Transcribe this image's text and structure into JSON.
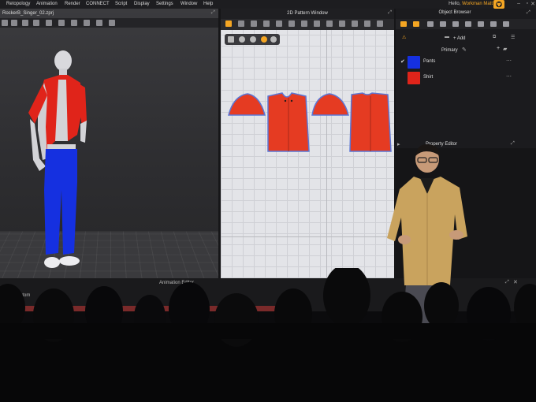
{
  "menu": {
    "items": [
      "Retopology",
      "Animation",
      "Render",
      "CONNECT",
      "Script",
      "Display",
      "Settings",
      "Window",
      "Help"
    ],
    "user_greeting": "Hello,",
    "user_name": "Workman Matt"
  },
  "viewport": {
    "file_name": "RockerB_Singer_02.zprj"
  },
  "pattern_window": {
    "title": "2D Pattern Window"
  },
  "object_browser": {
    "title": "Object Browser",
    "add_label": "+ Add",
    "group_label": "Primary",
    "items": [
      {
        "label": "Pants",
        "color": "#1530e0",
        "checked": true
      },
      {
        "label": "Shirt",
        "color": "#e0241a",
        "checked": false
      }
    ]
  },
  "property_editor": {
    "title": "Property Editor"
  },
  "timeline": {
    "title": "Animation Editor",
    "custom_label": "ustom"
  },
  "colors": {
    "accent": "#f5a623",
    "shirt": "#e0241a",
    "pants": "#1530e0",
    "pattern_red": "#e53b22",
    "pattern_outline": "#5a76d6"
  }
}
